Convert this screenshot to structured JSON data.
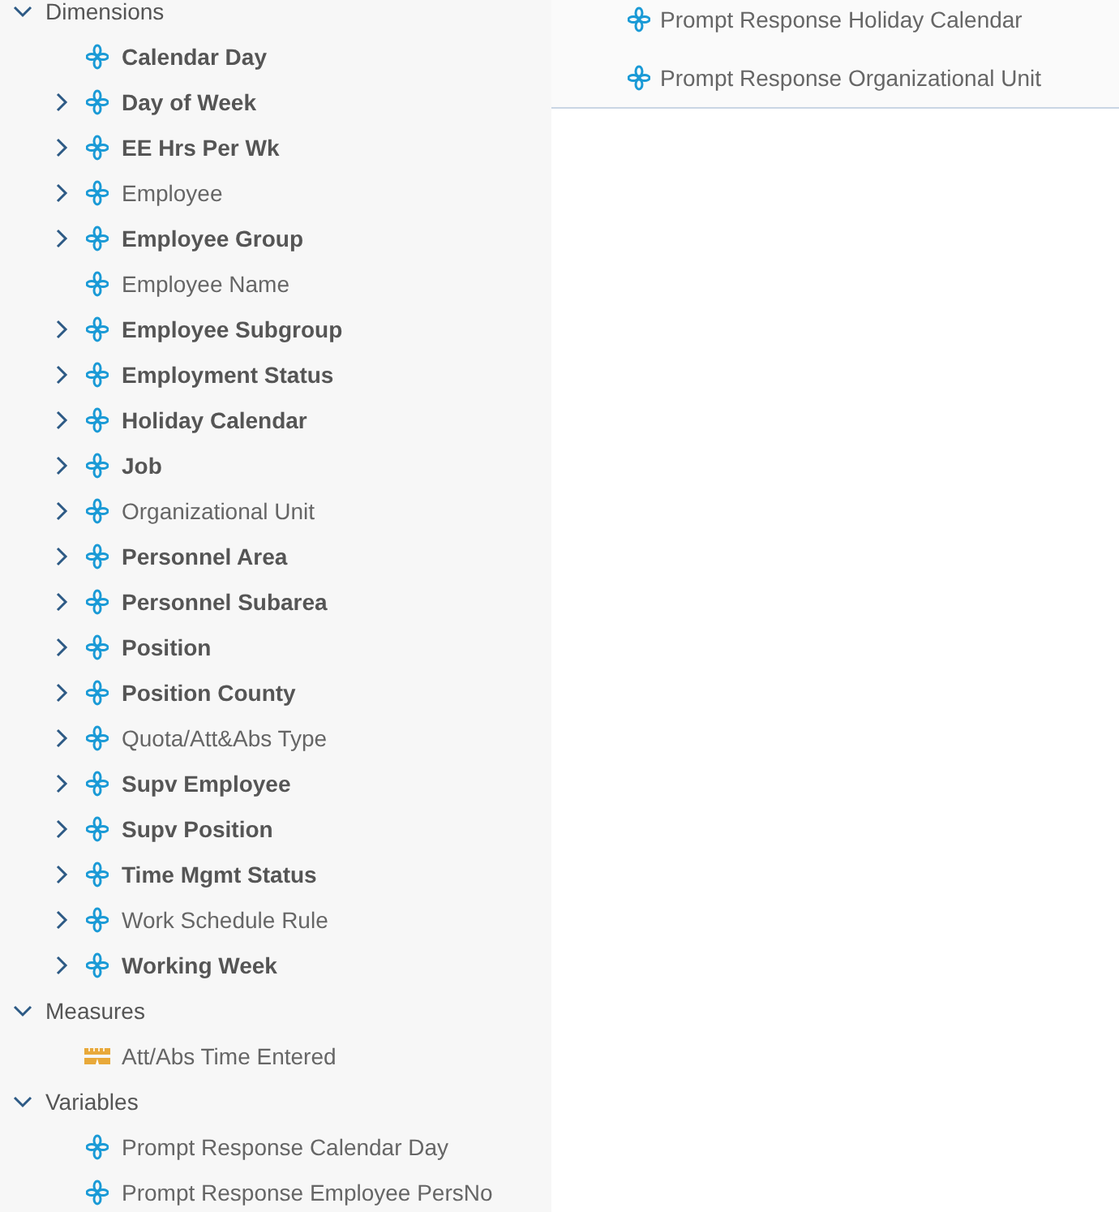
{
  "tree": [
    {
      "label": "Dimensions",
      "expanded": true,
      "children": [
        {
          "label": "Calendar Day",
          "kind": "dimension",
          "bold": true,
          "expandable": false
        },
        {
          "label": "Day of Week",
          "kind": "dimension",
          "bold": true,
          "expandable": true
        },
        {
          "label": "EE Hrs Per Wk",
          "kind": "dimension",
          "bold": true,
          "expandable": true
        },
        {
          "label": "Employee",
          "kind": "dimension",
          "bold": false,
          "expandable": true
        },
        {
          "label": "Employee Group",
          "kind": "dimension",
          "bold": true,
          "expandable": true
        },
        {
          "label": "Employee Name",
          "kind": "dimension",
          "bold": false,
          "expandable": false
        },
        {
          "label": "Employee Subgroup",
          "kind": "dimension",
          "bold": true,
          "expandable": true
        },
        {
          "label": "Employment Status",
          "kind": "dimension",
          "bold": true,
          "expandable": true
        },
        {
          "label": "Holiday Calendar",
          "kind": "dimension",
          "bold": true,
          "expandable": true
        },
        {
          "label": "Job",
          "kind": "dimension",
          "bold": true,
          "expandable": true
        },
        {
          "label": "Organizational Unit",
          "kind": "dimension",
          "bold": false,
          "expandable": true
        },
        {
          "label": "Personnel Area",
          "kind": "dimension",
          "bold": true,
          "expandable": true
        },
        {
          "label": "Personnel Subarea",
          "kind": "dimension",
          "bold": true,
          "expandable": true
        },
        {
          "label": "Position",
          "kind": "dimension",
          "bold": true,
          "expandable": true
        },
        {
          "label": "Position County",
          "kind": "dimension",
          "bold": true,
          "expandable": true
        },
        {
          "label": "Quota/Att&Abs Type",
          "kind": "dimension",
          "bold": false,
          "expandable": true
        },
        {
          "label": "Supv Employee",
          "kind": "dimension",
          "bold": true,
          "expandable": true
        },
        {
          "label": "Supv Position",
          "kind": "dimension",
          "bold": true,
          "expandable": true
        },
        {
          "label": "Time Mgmt Status",
          "kind": "dimension",
          "bold": true,
          "expandable": true
        },
        {
          "label": "Work Schedule Rule",
          "kind": "dimension",
          "bold": false,
          "expandable": true
        },
        {
          "label": "Working Week",
          "kind": "dimension",
          "bold": true,
          "expandable": true
        }
      ]
    },
    {
      "label": "Measures",
      "expanded": true,
      "children": [
        {
          "label": "Att/Abs Time Entered",
          "kind": "measure",
          "bold": false,
          "expandable": false
        }
      ]
    },
    {
      "label": "Variables",
      "expanded": true,
      "children": [
        {
          "label": "Prompt Response Calendar Day",
          "kind": "dimension",
          "bold": false,
          "expandable": false
        },
        {
          "label": "Prompt Response Employee PersNo",
          "kind": "dimension",
          "bold": false,
          "expandable": false
        }
      ]
    }
  ],
  "overlay_list": [
    {
      "label": "Prompt Response Holiday Calendar",
      "kind": "dimension"
    },
    {
      "label": "Prompt Response Organizational Unit",
      "kind": "dimension"
    }
  ]
}
